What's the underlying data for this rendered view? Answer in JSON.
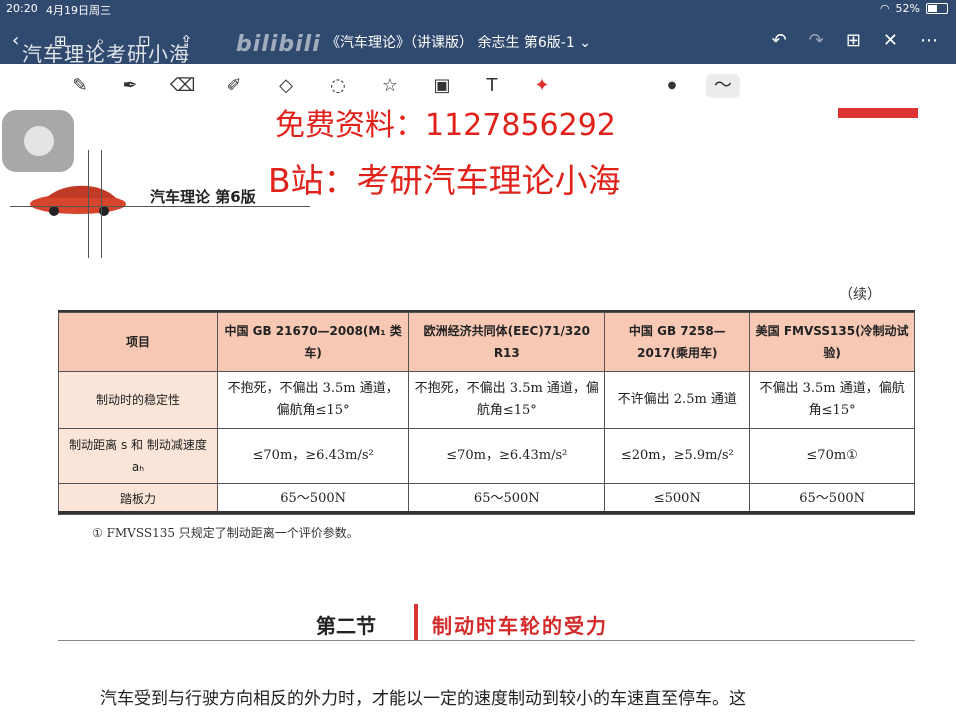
{
  "status_bar": {
    "time": "20:20",
    "date": "4月19日周三",
    "battery": "52%"
  },
  "header": {
    "doc_title": "《汽车理论》（讲课版） 余志生 第6版-1 ⌄",
    "watermark": "汽车理论考研小海",
    "bili": "bilibili"
  },
  "overlay": {
    "free": "免费资料：1127856292",
    "bzhan": "B站：考研汽车理论小海"
  },
  "book": {
    "running_head": "汽车理论   第6版",
    "continued": "（续）",
    "table": {
      "headers": [
        "项目",
        "中国 GB 21670—2008(M₁ 类车)",
        "欧洲经济共同体(EEC)71/320 R13",
        "中国 GB 7258—2017(乘用车)",
        "美国 FMVSS135(冷制动试验)"
      ],
      "rows": [
        {
          "label": "制动时的稳定性",
          "c1": "不抱死，不偏出 3.5m 通道，偏航角≤15°",
          "c2": "不抱死，不偏出 3.5m 通道，偏航角≤15°",
          "c3": "不许偏出 2.5m 通道",
          "c4": "不偏出 3.5m 通道，偏航角≤15°"
        },
        {
          "label": "制动距离 s 和 制动减速度 aₕ",
          "c1": "≤70m，≥6.43m/s²",
          "c2": "≤70m，≥6.43m/s²",
          "c3": "≤20m，≥5.9m/s²",
          "c4": "≤70m①"
        },
        {
          "label": "踏板力",
          "c1": "65～500N",
          "c2": "65～500N",
          "c3": "≤500N",
          "c4": "65～500N"
        }
      ]
    },
    "footnote": "① FMVSS135 只规定了制动距离一个评价参数。",
    "section_number": "第二节",
    "section_title": "制动时车轮的受力",
    "paragraph": "汽车受到与行驶方向相反的外力时，才能以一定的速度制动到较小的车速直至停车。这"
  },
  "toolbar_icons": [
    "lasso-text-icon",
    "pen-icon",
    "eraser-icon",
    "highlighter-icon",
    "shapes-icon",
    "lasso-icon",
    "sticker-icon",
    "image-icon",
    "textbox-icon",
    "laser-icon",
    "dot-size-icon",
    "line-style-icon"
  ]
}
